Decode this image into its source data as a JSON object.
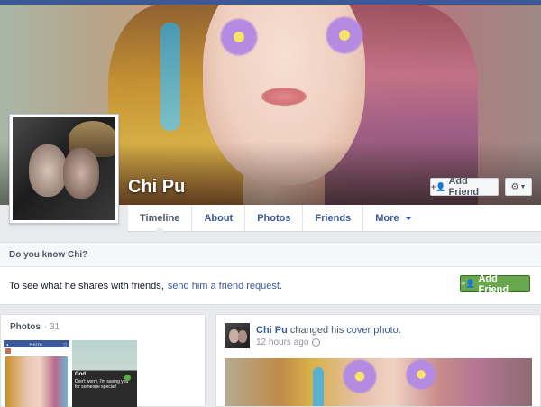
{
  "profile": {
    "name": "Chi Pu",
    "add_friend_label": "Add Friend"
  },
  "tabs": [
    {
      "label": "Timeline",
      "active": true
    },
    {
      "label": "About"
    },
    {
      "label": "Photos"
    },
    {
      "label": "Friends"
    },
    {
      "label": "More"
    }
  ],
  "know_card": {
    "title": "Do you know Chi?",
    "body_text": "To see what he shares with friends,",
    "link_text": "send him a friend request.",
    "button_label": "Add Friend"
  },
  "photos_card": {
    "title": "Photos",
    "count": "· 31",
    "thumb1_bar_left": "◂",
    "thumb1_bar_title": "PHOTO",
    "thumb1_bar_right": "▢",
    "thumb2_sender": "God",
    "thumb2_message": "Don't worry, I'm saving you for someone special!"
  },
  "story": {
    "author": "Chi Pu",
    "action": "changed his",
    "object": "cover photo.",
    "time": "12 hours ago"
  },
  "colors": {
    "brand_blue": "#3b5998",
    "green_button": "#69a74e"
  },
  "icons": {
    "add_friend": "add-friend-icon",
    "gear": "gear-icon",
    "dropdown": "chevron-down-icon",
    "privacy": "globe-icon"
  }
}
